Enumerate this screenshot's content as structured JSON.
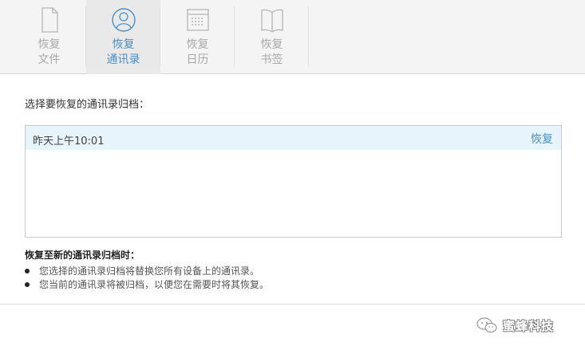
{
  "toolbar": {
    "tabs": [
      {
        "line1": "恢复",
        "line2": "文件",
        "icon": "file-icon",
        "active": false
      },
      {
        "line1": "恢复",
        "line2": "通讯录",
        "icon": "contacts-icon",
        "active": true
      },
      {
        "line1": "恢复",
        "line2": "日历",
        "icon": "calendar-icon",
        "active": false
      },
      {
        "line1": "恢复",
        "line2": "书签",
        "icon": "bookmark-icon",
        "active": false
      }
    ]
  },
  "main": {
    "prompt": "选择要恢复的通讯录归档：",
    "archives": [
      {
        "date": "昨天上午10:01",
        "action": "恢复"
      }
    ]
  },
  "notes": {
    "title": "恢复至新的通讯录归档时：",
    "items": [
      "您选择的通讯录归档将替换您所有设备上的通讯录。",
      "您当前的通讯录将被归档，以便您在需要时将其恢复。"
    ]
  },
  "watermark": {
    "text": "蜜蜂科技",
    "icon": "wechat-icon"
  },
  "colors": {
    "accent": "#4a90c8",
    "inactive": "#a9a9a9",
    "selected_row": "#e8f4fc"
  }
}
